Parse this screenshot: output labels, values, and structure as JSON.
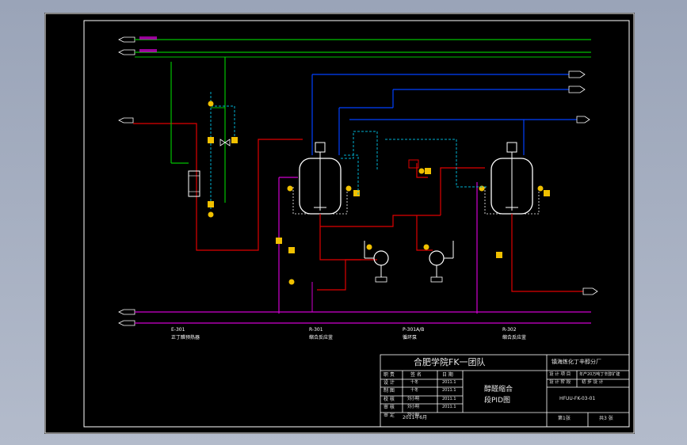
{
  "title_block": {
    "org": "合肥学院FK一团队",
    "company": "镇海炼化丁辛醇分厂",
    "drawing_name_line1": "醇醛缩合",
    "drawing_name_line2": "段PID图",
    "header_labels": [
      "职 责",
      "签 名",
      "日 期"
    ],
    "role_labels": [
      "设 计",
      "制 图",
      "校 核",
      "审 核",
      "审 定"
    ],
    "signatures": [
      "十冬",
      "十冬",
      "刘小明",
      "刘小明",
      "刘小明"
    ],
    "dates": [
      "2011.1",
      "2011.1",
      "2011.1",
      "2011.1",
      "2011.1"
    ],
    "completion_date": "2011年6月",
    "project_label": "设 计 项 目",
    "project_value": "年产20万吨丁辛醇扩建",
    "stage_label": "设 计 阶 段",
    "stage_value": "初 步 设 计",
    "drawing_number": "HFUU-FK-03-01",
    "sheet_count": "第1张",
    "total_sheets": "共3 张"
  },
  "equipment_labels": [
    {
      "tag": "E-301",
      "name": "正丁醛预热器"
    },
    {
      "tag": "R-301",
      "name": "缩合反应釜"
    },
    {
      "tag": "P-301A/B",
      "name": "循环泵"
    },
    {
      "tag": "R-302",
      "name": "缩合反应釜"
    }
  ],
  "colors": {
    "steam_line": "#00c000",
    "water_line": "#0000ff",
    "process_line": "#e00000",
    "utility_line": "#d000d0",
    "instrument_line": "#00b0d0",
    "equipment": "#ffffff",
    "instrument": "#f0c000"
  }
}
